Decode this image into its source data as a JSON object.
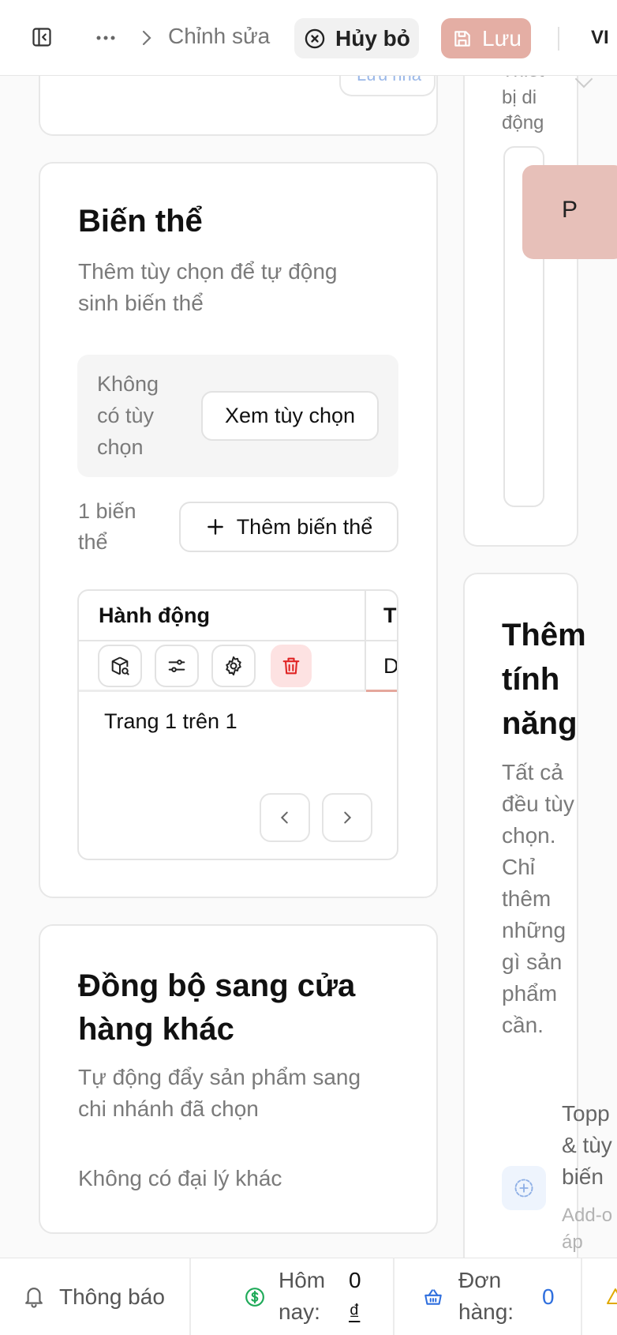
{
  "topbar": {
    "crumb_current": "Chỉnh sửa",
    "cancel_label": "Hủy bỏ",
    "save_label": "Lưu",
    "language": "VI",
    "partial_badge": "Lưu nhá"
  },
  "variants_card": {
    "title": "Biến thể",
    "subtitle_line1": "Thêm tùy chọn để tự động",
    "subtitle_line2": "sinh biến thể",
    "no_options_line1": "Không",
    "no_options_line2": "có tùy",
    "no_options_line3": "chọn",
    "view_options_label": "Xem tùy chọn",
    "count_line1": "1 biến",
    "count_line2": "thể",
    "add_variant_label": "Thêm biến thể",
    "table": {
      "col_actions": "Hành động",
      "col_next": "Tê",
      "row_next_cell": "D",
      "pagination": "Trang 1 trên 1"
    }
  },
  "sync_card": {
    "title_line1": "Đồng bộ sang cửa",
    "title_line2": "hàng khác",
    "subtitle_line1": "Tự động đẩy sản phẩm sang",
    "subtitle_line2": "chi nhánh đã chọn",
    "empty": "Không có đại lý khác"
  },
  "preview_card": {
    "label_line1": "Thiết",
    "label_line2": "bị di",
    "label_line3": "động",
    "avatar_letter": "P"
  },
  "features_card": {
    "title_line1": "Thêm",
    "title_line2": "tính",
    "title_line3": "năng",
    "desc_lines": [
      "Tất cả",
      "đều tùy",
      "chọn.",
      "Chỉ",
      "thêm",
      "những",
      "gì sản",
      "phẩm",
      "cần."
    ],
    "item_title_lines": [
      "Topp",
      "& tùy",
      "biến"
    ],
    "item_desc_lines": [
      "Add-o",
      "áp dụn"
    ]
  },
  "bottombar": {
    "notifications": "Thông báo",
    "today_line1": "Hôm",
    "today_line2": "nay:",
    "today_value_line1": "0",
    "today_value_line2": "₫",
    "orders_line1": "Đơn",
    "orders_line2": "hàng:",
    "orders_value": "0"
  },
  "colors": {
    "save_bg": "#e4aea4",
    "danger": "#e02424",
    "orders_blue": "#2f6fde",
    "money_green": "#1faa59"
  }
}
